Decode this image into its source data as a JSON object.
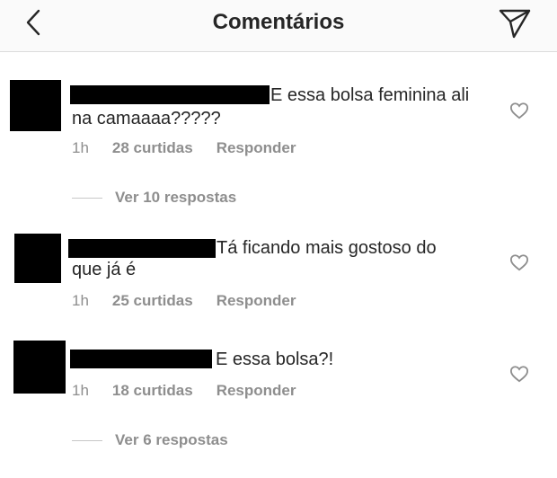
{
  "header": {
    "title": "Comentários",
    "back_icon": "chevron-left-icon",
    "send_icon": "paper-plane-icon"
  },
  "comments": [
    {
      "text_line1": "E essa bolsa feminina ali",
      "text_line2": "na camaaaa?????",
      "time": "1h",
      "likes": "28 curtidas",
      "reply": "Responder",
      "view_replies": "Ver 10 respostas"
    },
    {
      "text_line1": "Tá ficando mais gostoso do",
      "text_line2": "que já é",
      "time": "1h",
      "likes": "25 curtidas",
      "reply": "Responder"
    },
    {
      "text_line1": "E essa bolsa?!",
      "time": "1h",
      "likes": "18 curtidas",
      "reply": "Responder",
      "view_replies": "Ver 6 respostas"
    }
  ],
  "colors": {
    "text": "#262626",
    "muted": "#8e8e8e",
    "divider": "#dbdbdb",
    "header_bg": "#fafafa"
  }
}
